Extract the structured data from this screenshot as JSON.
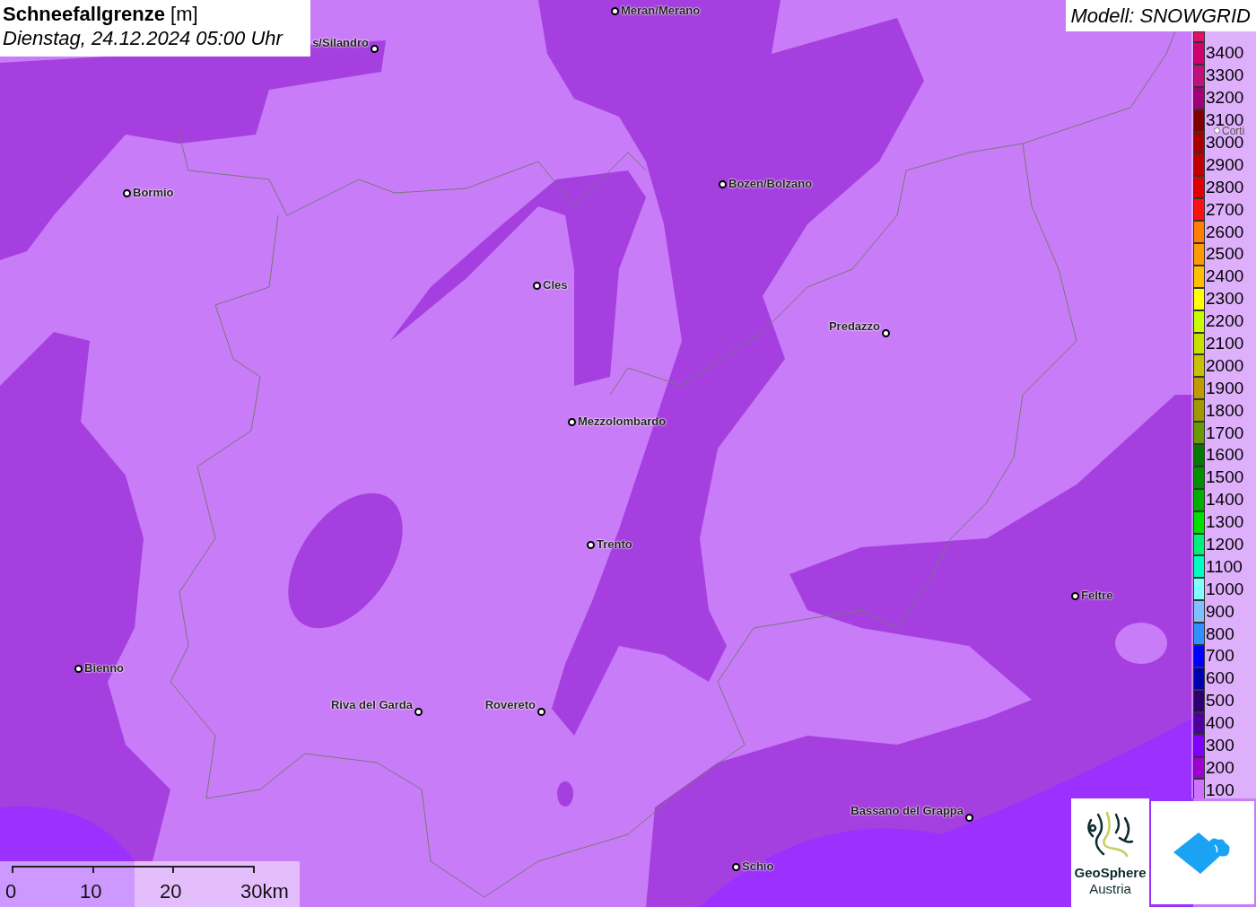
{
  "header": {
    "title": "Schneefallgrenze",
    "unit": "[m]",
    "datetime": "Dienstag, 24.12.2024 05:00 Uhr"
  },
  "model_label": "Modell: SNOWGRID",
  "cities": [
    {
      "name": "Meran/Merano"
    },
    {
      "name": "s/Silandro"
    },
    {
      "name": "Bormio"
    },
    {
      "name": "Bozen/Bolzano"
    },
    {
      "name": "Cles"
    },
    {
      "name": "Predazzo"
    },
    {
      "name": "Mezzolombardo"
    },
    {
      "name": "Trento"
    },
    {
      "name": "Feltre"
    },
    {
      "name": "Bienno"
    },
    {
      "name": "Riva del Garda"
    },
    {
      "name": "Rovereto"
    },
    {
      "name": "Bassano del Grappa"
    },
    {
      "name": "Schio"
    },
    {
      "name": "Corti"
    }
  ],
  "legend": [
    {
      "label": "3400",
      "color": "#d0006e"
    },
    {
      "label": "3300",
      "color": "#c0107a"
    },
    {
      "label": "3200",
      "color": "#a0007a"
    },
    {
      "label": "3100",
      "color": "#800000"
    },
    {
      "label": "3000",
      "color": "#a80000"
    },
    {
      "label": "2900",
      "color": "#c00000"
    },
    {
      "label": "2800",
      "color": "#e00000"
    },
    {
      "label": "2700",
      "color": "#ff1010"
    },
    {
      "label": "2600",
      "color": "#ff8000"
    },
    {
      "label": "2500",
      "color": "#ff9a00"
    },
    {
      "label": "2400",
      "color": "#ffbf00"
    },
    {
      "label": "2300",
      "color": "#ffff00"
    },
    {
      "label": "2200",
      "color": "#c8ff00"
    },
    {
      "label": "2100",
      "color": "#c8e000"
    },
    {
      "label": "2000",
      "color": "#c8c000"
    },
    {
      "label": "1900",
      "color": "#c09a00"
    },
    {
      "label": "1800",
      "color": "#a09a00"
    },
    {
      "label": "1700",
      "color": "#6a9a00"
    },
    {
      "label": "1600",
      "color": "#007a00"
    },
    {
      "label": "1500",
      "color": "#009000"
    },
    {
      "label": "1400",
      "color": "#00b000"
    },
    {
      "label": "1300",
      "color": "#00e000"
    },
    {
      "label": "1200",
      "color": "#00f080"
    },
    {
      "label": "1100",
      "color": "#00ffc0"
    },
    {
      "label": "1000",
      "color": "#80ffff"
    },
    {
      "label": "900",
      "color": "#80c0ff"
    },
    {
      "label": "800",
      "color": "#3090ff"
    },
    {
      "label": "700",
      "color": "#0000ff"
    },
    {
      "label": "600",
      "color": "#0000b0"
    },
    {
      "label": "500",
      "color": "#300070"
    },
    {
      "label": "400",
      "color": "#5000a0"
    },
    {
      "label": "300",
      "color": "#8000ff"
    },
    {
      "label": "200",
      "color": "#a000d0"
    },
    {
      "label": "100",
      "color": "#d070ff"
    }
  ],
  "scale_bar": {
    "ticks": [
      "0",
      "10",
      "20",
      "30km"
    ]
  },
  "logos": [
    {
      "kind": "geosphere",
      "line_1": "GeoSphere",
      "line_2": "Austria"
    },
    {
      "kind": "cloud"
    }
  ]
}
